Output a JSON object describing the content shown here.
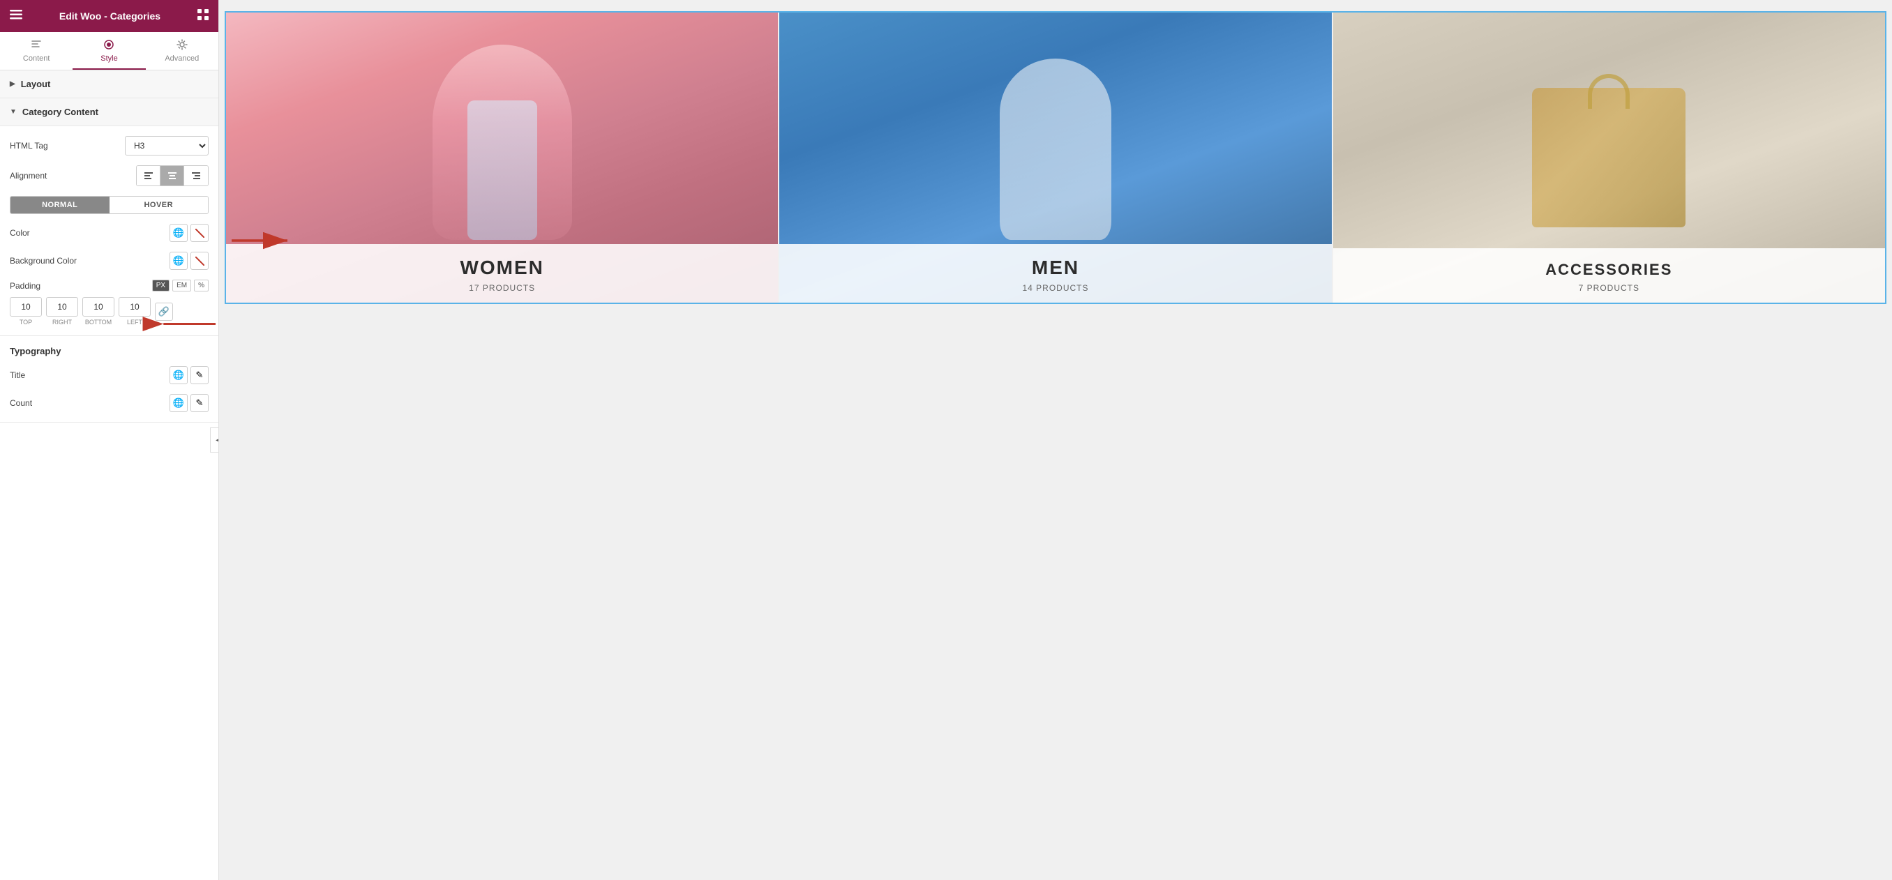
{
  "header": {
    "title": "Edit Woo - Categories",
    "hamburger_unicode": "☰",
    "grid_unicode": "⊞"
  },
  "tabs": [
    {
      "label": "Content",
      "icon": "pencil",
      "active": false
    },
    {
      "label": "Style",
      "icon": "palette",
      "active": true
    },
    {
      "label": "Advanced",
      "icon": "gear",
      "active": false
    }
  ],
  "sections": {
    "layout": {
      "label": "Layout",
      "collapsed": true
    },
    "category_content": {
      "label": "Category Content",
      "collapsed": false,
      "html_tag": {
        "label": "HTML Tag",
        "value": "H3"
      },
      "alignment": {
        "label": "Alignment",
        "options": [
          "left",
          "center",
          "right"
        ]
      },
      "states": {
        "normal": "NORMAL",
        "hover": "HOVER",
        "active": "normal"
      },
      "color": {
        "label": "Color"
      },
      "background_color": {
        "label": "Background Color"
      },
      "padding": {
        "label": "Padding",
        "units": [
          "PX",
          "EM",
          "%"
        ],
        "active_unit": "PX",
        "values": {
          "top": "10",
          "right": "10",
          "bottom": "10",
          "left": "10"
        }
      }
    },
    "typography": {
      "label": "Typography",
      "title_row": {
        "label": "Title"
      },
      "count_row": {
        "label": "Count"
      }
    }
  },
  "categories": [
    {
      "name": "WOMEN",
      "count": "17 PRODUCTS",
      "color_theme": "pink"
    },
    {
      "name": "MEN",
      "count": "14 PRODUCTS",
      "color_theme": "blue"
    },
    {
      "name": "ACCESSORIES",
      "count": "7 PRODUCTS",
      "color_theme": "gray"
    }
  ],
  "icons": {
    "globe": "🌐",
    "pencil": "✎",
    "link": "🔗",
    "slash": "✕"
  }
}
